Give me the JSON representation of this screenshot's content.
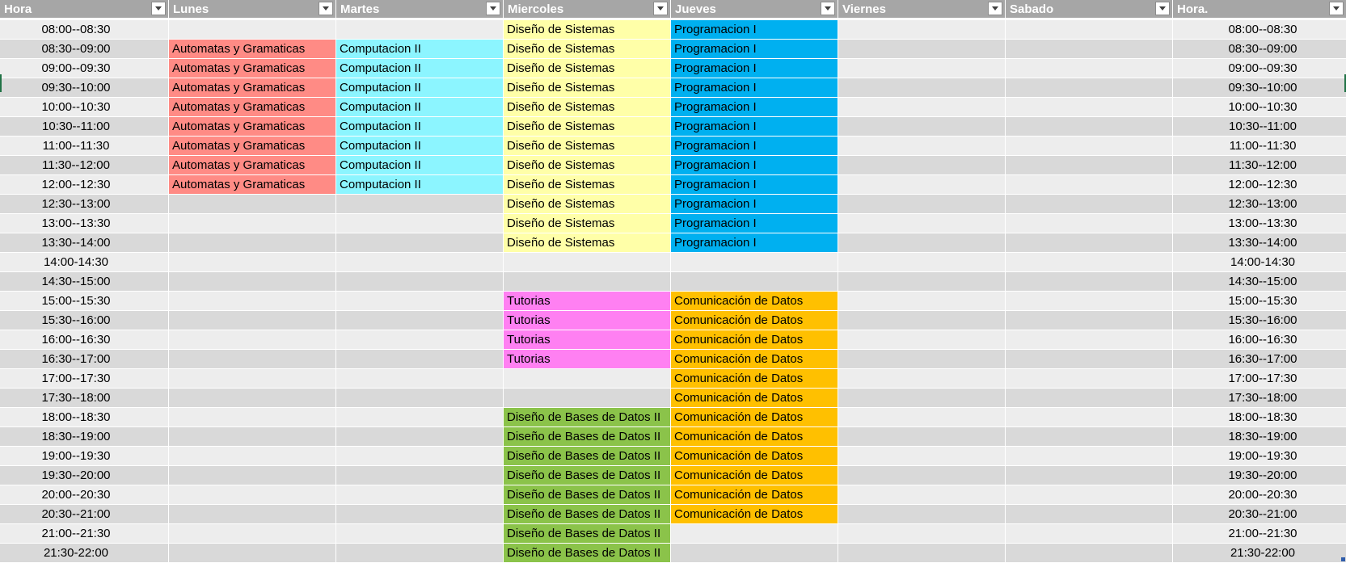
{
  "headers": [
    "Hora",
    "Lunes",
    "Martes",
    "Miercoles",
    "Jueves",
    "Viernes",
    "Sabado",
    "Hora."
  ],
  "filter_icon": "chevron-down-icon",
  "subject_colors": {
    "aut": "#ff8b85",
    "comp": "#8cf5ff",
    "dis": "#ffffa8",
    "prog": "#00b0f0",
    "tut": "#ff80f2",
    "com": "#ffc000",
    "bd": "#8bc34a"
  },
  "rows": [
    {
      "hora": "08:00--08:30",
      "lunes": "",
      "martes": "",
      "miercoles": "Diseño de Sistemas",
      "jueves": "Programacion I",
      "viernes": "",
      "sabado": "",
      "hora2": "08:00--08:30"
    },
    {
      "hora": "08:30--09:00",
      "lunes": "Automatas y Gramaticas",
      "martes": "Computacion II",
      "miercoles": "Diseño de Sistemas",
      "jueves": "Programacion I",
      "viernes": "",
      "sabado": "",
      "hora2": "08:30--09:00"
    },
    {
      "hora": "09:00--09:30",
      "lunes": "Automatas y Gramaticas",
      "martes": "Computacion II",
      "miercoles": "Diseño de Sistemas",
      "jueves": "Programacion I",
      "viernes": "",
      "sabado": "",
      "hora2": "09:00--09:30"
    },
    {
      "hora": "09:30--10:00",
      "lunes": "Automatas y Gramaticas",
      "martes": "Computacion II",
      "miercoles": "Diseño de Sistemas",
      "jueves": "Programacion I",
      "viernes": "",
      "sabado": "",
      "hora2": "09:30--10:00"
    },
    {
      "hora": "10:00--10:30",
      "lunes": "Automatas y Gramaticas",
      "martes": "Computacion II",
      "miercoles": "Diseño de Sistemas",
      "jueves": "Programacion I",
      "viernes": "",
      "sabado": "",
      "hora2": "10:00--10:30"
    },
    {
      "hora": "10:30--11:00",
      "lunes": "Automatas y Gramaticas",
      "martes": "Computacion II",
      "miercoles": "Diseño de Sistemas",
      "jueves": "Programacion I",
      "viernes": "",
      "sabado": "",
      "hora2": "10:30--11:00"
    },
    {
      "hora": "11:00--11:30",
      "lunes": "Automatas y Gramaticas",
      "martes": "Computacion II",
      "miercoles": "Diseño de Sistemas",
      "jueves": "Programacion I",
      "viernes": "",
      "sabado": "",
      "hora2": "11:00--11:30"
    },
    {
      "hora": "11:30--12:00",
      "lunes": "Automatas y Gramaticas",
      "martes": "Computacion II",
      "miercoles": "Diseño de Sistemas",
      "jueves": "Programacion I",
      "viernes": "",
      "sabado": "",
      "hora2": "11:30--12:00"
    },
    {
      "hora": "12:00--12:30",
      "lunes": "Automatas y Gramaticas",
      "martes": "Computacion II",
      "miercoles": "Diseño de Sistemas",
      "jueves": "Programacion I",
      "viernes": "",
      "sabado": "",
      "hora2": "12:00--12:30"
    },
    {
      "hora": "12:30--13:00",
      "lunes": "",
      "martes": "",
      "miercoles": "Diseño de Sistemas",
      "jueves": "Programacion I",
      "viernes": "",
      "sabado": "",
      "hora2": "12:30--13:00"
    },
    {
      "hora": "13:00--13:30",
      "lunes": "",
      "martes": "",
      "miercoles": "Diseño de Sistemas",
      "jueves": "Programacion I",
      "viernes": "",
      "sabado": "",
      "hora2": "13:00--13:30"
    },
    {
      "hora": "13:30--14:00",
      "lunes": "",
      "martes": "",
      "miercoles": "Diseño de Sistemas",
      "jueves": "Programacion I",
      "viernes": "",
      "sabado": "",
      "hora2": "13:30--14:00"
    },
    {
      "hora": "14:00-14:30",
      "lunes": "",
      "martes": "",
      "miercoles": "",
      "jueves": "",
      "viernes": "",
      "sabado": "",
      "hora2": "14:00-14:30"
    },
    {
      "hora": "14:30--15:00",
      "lunes": "",
      "martes": "",
      "miercoles": "",
      "jueves": "",
      "viernes": "",
      "sabado": "",
      "hora2": "14:30--15:00"
    },
    {
      "hora": "15:00--15:30",
      "lunes": "",
      "martes": "",
      "miercoles": "Tutorias",
      "jueves": "Comunicación de Datos",
      "viernes": "",
      "sabado": "",
      "hora2": "15:00--15:30"
    },
    {
      "hora": "15:30--16:00",
      "lunes": "",
      "martes": "",
      "miercoles": "Tutorias",
      "jueves": "Comunicación de Datos",
      "viernes": "",
      "sabado": "",
      "hora2": "15:30--16:00"
    },
    {
      "hora": "16:00--16:30",
      "lunes": "",
      "martes": "",
      "miercoles": "Tutorias",
      "jueves": "Comunicación de Datos",
      "viernes": "",
      "sabado": "",
      "hora2": "16:00--16:30"
    },
    {
      "hora": "16:30--17:00",
      "lunes": "",
      "martes": "",
      "miercoles": "Tutorias",
      "jueves": "Comunicación de Datos",
      "viernes": "",
      "sabado": "",
      "hora2": "16:30--17:00"
    },
    {
      "hora": "17:00--17:30",
      "lunes": "",
      "martes": "",
      "miercoles": "",
      "jueves": "Comunicación de Datos",
      "viernes": "",
      "sabado": "",
      "hora2": "17:00--17:30"
    },
    {
      "hora": "17:30--18:00",
      "lunes": "",
      "martes": "",
      "miercoles": "",
      "jueves": "Comunicación de Datos",
      "viernes": "",
      "sabado": "",
      "hora2": "17:30--18:00"
    },
    {
      "hora": "18:00--18:30",
      "lunes": "",
      "martes": "",
      "miercoles": "Diseño de Bases de Datos II",
      "jueves": "Comunicación de Datos",
      "viernes": "",
      "sabado": "",
      "hora2": "18:00--18:30"
    },
    {
      "hora": "18:30--19:00",
      "lunes": "",
      "martes": "",
      "miercoles": "Diseño de Bases de Datos II",
      "jueves": "Comunicación de Datos",
      "viernes": "",
      "sabado": "",
      "hora2": "18:30--19:00"
    },
    {
      "hora": "19:00--19:30",
      "lunes": "",
      "martes": "",
      "miercoles": "Diseño de Bases de Datos II",
      "jueves": "Comunicación de Datos",
      "viernes": "",
      "sabado": "",
      "hora2": "19:00--19:30"
    },
    {
      "hora": "19:30--20:00",
      "lunes": "",
      "martes": "",
      "miercoles": "Diseño de Bases de Datos II",
      "jueves": "Comunicación de Datos",
      "viernes": "",
      "sabado": "",
      "hora2": "19:30--20:00"
    },
    {
      "hora": "20:00--20:30",
      "lunes": "",
      "martes": "",
      "miercoles": "Diseño de Bases de Datos II",
      "jueves": "Comunicación de Datos",
      "viernes": "",
      "sabado": "",
      "hora2": "20:00--20:30"
    },
    {
      "hora": "20:30--21:00",
      "lunes": "",
      "martes": "",
      "miercoles": "Diseño de Bases de Datos II",
      "jueves": "Comunicación de Datos",
      "viernes": "",
      "sabado": "",
      "hora2": "20:30--21:00"
    },
    {
      "hora": "21:00--21:30",
      "lunes": "",
      "martes": "",
      "miercoles": "Diseño de Bases de Datos II",
      "jueves": "",
      "viernes": "",
      "sabado": "",
      "hora2": "21:00--21:30"
    },
    {
      "hora": "21:30-22:00",
      "lunes": "",
      "martes": "",
      "miercoles": "Diseño de Bases de Datos II",
      "jueves": "",
      "viernes": "",
      "sabado": "",
      "hora2": "21:30-22:00"
    }
  ]
}
